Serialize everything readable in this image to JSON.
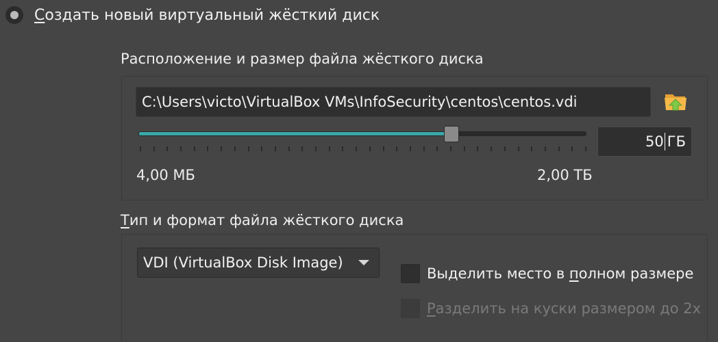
{
  "create_option": {
    "label_mnemonic": "С",
    "label_rest": "оздать новый виртуальный жёсткий диск"
  },
  "location_group": {
    "title": "Расположение и размер файла жёсткого диска",
    "path_value": "C:\\Users\\victo\\VirtualBox VMs\\InfoSecurity\\centos\\centos.vdi",
    "folder_icon": "folder-up-icon",
    "size": {
      "value": "50",
      "unit": "ГБ",
      "min_label": "4,00 МБ",
      "max_label": "2,00 ТБ",
      "slider_fraction": 0.7
    }
  },
  "type_group": {
    "title_mnemonic": "Т",
    "title_rest": "ип и формат файла жёсткого диска",
    "format_selected": "VDI (VirtualBox Disk Image)",
    "preallocate": {
      "label_before": "Выделить место в ",
      "label_mnemonic": "п",
      "label_after": "олном размере",
      "checked": false
    },
    "split": {
      "label_mnemonic": "Р",
      "label_rest": "азделить на куски размером до 2х",
      "checked": false,
      "disabled": true
    }
  },
  "colors": {
    "background": "#454545",
    "accent": "#3aa8a8",
    "field": "#2f2f2f"
  }
}
